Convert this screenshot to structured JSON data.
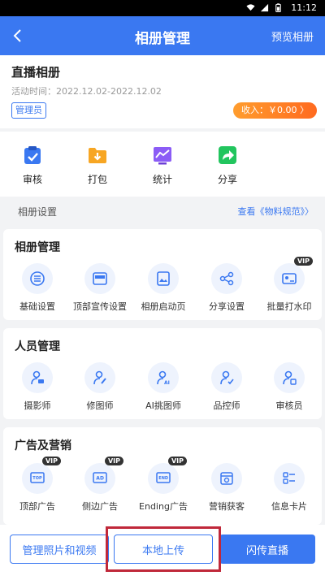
{
  "status_bar": {
    "time": "11:12"
  },
  "header": {
    "title": "相册管理",
    "preview_label": "预览相册"
  },
  "album": {
    "name": "直播相册",
    "time_label": "活动时间：",
    "time_value": "2022.12.02-2022.12.02",
    "role": "管理员",
    "income": "收入：￥0.00 〉"
  },
  "actions": [
    {
      "label": "审核",
      "icon": "clipboard-check-icon"
    },
    {
      "label": "打包",
      "icon": "folder-download-icon"
    },
    {
      "label": "统计",
      "icon": "chart-icon"
    },
    {
      "label": "分享",
      "icon": "share-arrow-icon"
    }
  ],
  "settings": {
    "label": "相册设置",
    "link": "查看《物料规范》〉"
  },
  "sections": {
    "album_mgmt": {
      "title": "相册管理",
      "items": [
        {
          "label": "基础设置",
          "icon": "list-icon"
        },
        {
          "label": "顶部宣传设置",
          "icon": "banner-icon"
        },
        {
          "label": "相册启动页",
          "icon": "image-icon"
        },
        {
          "label": "分享设置",
          "icon": "share-nodes-icon"
        },
        {
          "label": "批量打水印",
          "icon": "watermark-icon",
          "badge": "VIP"
        }
      ]
    },
    "people_mgmt": {
      "title": "人员管理",
      "items": [
        {
          "label": "摄影师",
          "icon": "camera-person-icon"
        },
        {
          "label": "修图师",
          "icon": "retouch-person-icon"
        },
        {
          "label": "AI挑图师",
          "icon": "ai-person-icon"
        },
        {
          "label": "品控师",
          "icon": "quality-person-icon"
        },
        {
          "label": "审核员",
          "icon": "reviewer-person-icon"
        }
      ]
    },
    "ads": {
      "title": "广告及营销",
      "items": [
        {
          "label": "顶部广告",
          "icon": "top-ad-icon",
          "badge": "VIP"
        },
        {
          "label": "侧边广告",
          "icon": "side-ad-icon",
          "badge": "VIP"
        },
        {
          "label": "Ending广告",
          "icon": "end-ad-icon",
          "badge": "VIP"
        },
        {
          "label": "营销获客",
          "icon": "marketing-icon"
        },
        {
          "label": "信息卡片",
          "icon": "info-card-icon"
        }
      ]
    }
  },
  "bottom": {
    "manage_label": "管理照片和视频",
    "upload_label": "本地上传",
    "live_label": "闪传直播"
  },
  "colors": {
    "primary": "#3a78f1",
    "highlight": "#c0283a",
    "income_start": "#ff9d2e",
    "income_end": "#ff6a1f"
  }
}
